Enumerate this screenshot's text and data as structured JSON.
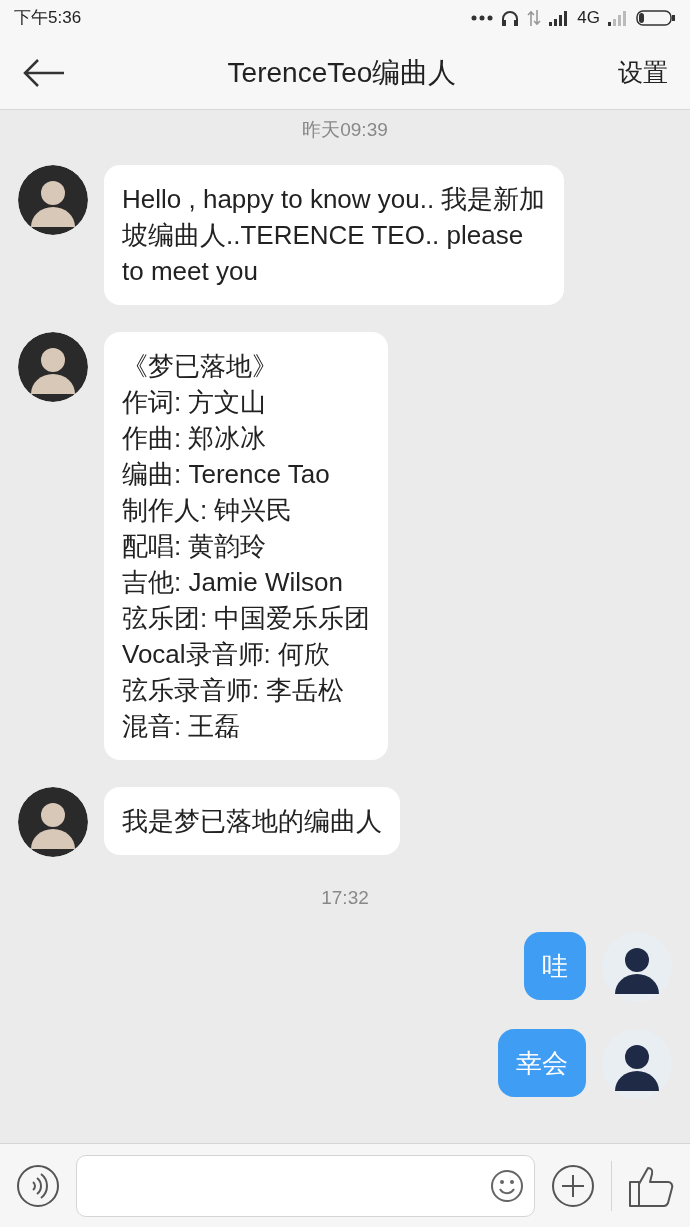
{
  "status_bar": {
    "time": "下午5:36",
    "network": "4G"
  },
  "header": {
    "title": "TerenceTeo编曲人",
    "action": "设置"
  },
  "messages": [
    {
      "kind": "time",
      "text": "昨天09:39"
    },
    {
      "kind": "incoming",
      "lines": [
        "Hello , happy to know you.. 我是新加坡编曲人..TERENCE TEO.. please to meet you"
      ]
    },
    {
      "kind": "incoming",
      "lines": [
        "《梦已落地》",
        "作词: 方文山",
        "作曲: 郑冰冰",
        "编曲: Terence Tao",
        "制作人: 钟兴民",
        "配唱: 黄韵玲",
        "吉他: Jamie Wilson",
        "弦乐团: 中国爱乐乐团",
        "Vocal录音师: 何欣",
        "弦乐录音师: 李岳松",
        "混音: 王磊"
      ]
    },
    {
      "kind": "incoming",
      "lines": [
        "我是梦已落地的编曲人"
      ]
    },
    {
      "kind": "time",
      "text": "17:32"
    },
    {
      "kind": "outgoing",
      "lines": [
        "哇"
      ]
    },
    {
      "kind": "outgoing",
      "lines": [
        "幸会"
      ]
    }
  ]
}
